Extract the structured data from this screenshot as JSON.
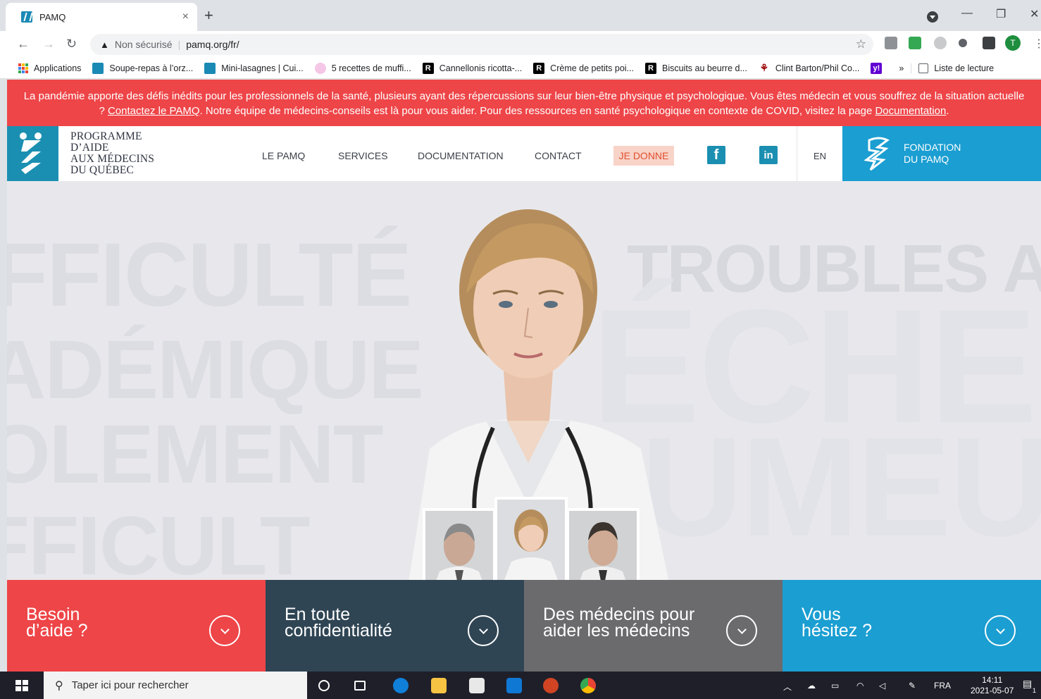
{
  "browser": {
    "tab_title": "PAMQ",
    "tab_close": "×",
    "new_tab": "+",
    "address_warning": "Non sécurisé",
    "address_url": "pamq.org/fr/",
    "bookmarks": [
      {
        "label": "Applications",
        "icon": "apps-grid-icon",
        "color": "#ea4335"
      },
      {
        "label": "Soupe-repas à l’orz...",
        "icon": "pamq-favicon-icon",
        "color": "#1a8ab5"
      },
      {
        "label": "Mini-lasagnes | Cui...",
        "icon": "pamq-favicon-icon",
        "color": "#1a8ab5"
      },
      {
        "label": "5 recettes de muffi...",
        "icon": "pink-circle-icon",
        "color": "#f5c6e6"
      },
      {
        "label": "Cannellonis ricotta-...",
        "icon": "r-icon",
        "color": "#000000"
      },
      {
        "label": "Crème de petits poi...",
        "icon": "r-icon",
        "color": "#000000"
      },
      {
        "label": "Biscuits au beurre d...",
        "icon": "r-icon",
        "color": "#000000"
      },
      {
        "label": "Clint Barton/Phil Co...",
        "icon": "ao3-icon",
        "color": "#990000"
      },
      {
        "label": "",
        "icon": "yahoo-icon",
        "color": "#6001d2"
      }
    ],
    "bookmarks_more": "»",
    "reading_list": "Liste de lecture"
  },
  "banner": {
    "text_1": "La pandémie apporte des défis inédits pour les professionnels de la santé, plusieurs ayant des répercussions sur leur bien-être physique et psychologique. Vous êtes médecin et vous souffrez de la situation actuelle ? ",
    "link_contact": "Contactez le PAMQ",
    "text_2": ". Notre équipe de médecins-conseils est là pour vous aider. Pour des ressources en santé psychologique en contexte de COVID, visitez la page ",
    "link_docs": "Documentation",
    "text_3": "."
  },
  "header": {
    "logo_lines": [
      "PROGRAMME",
      "D’AIDE",
      "AUX MÉDECINS",
      "DU QUÉBEC"
    ],
    "nav": [
      "LE PAMQ",
      "SERVICES",
      "DOCUMENTATION",
      "CONTACT"
    ],
    "donate": "JE DONNE",
    "lang": "EN",
    "fondation_line1": "FONDATION",
    "fondation_line2": "DU PAMQ",
    "brand_color": "#1b8fb1",
    "accent_color": "#ee4548"
  },
  "hero": {
    "bg_words": [
      "FFICULTÉ",
      "TROUBLES AN",
      "ADÉMIQUE",
      "ÉCHE",
      "OLEMENT",
      "UMEU",
      "FFICULT"
    ]
  },
  "cards": [
    {
      "line1": "Besoin",
      "line2": "d’aide ?",
      "color": "#ee4548"
    },
    {
      "line1": "En toute",
      "line2": "confidentialité",
      "color": "#2f4554"
    },
    {
      "line1": "Des médecins pour",
      "line2": "aider les médecins",
      "color": "#6b6b6d"
    },
    {
      "line1": "Vous",
      "line2": "hésitez ?",
      "color": "#1b9ed1"
    }
  ],
  "taskbar": {
    "search_placeholder": "Taper ici pour rechercher",
    "lang": "FRA",
    "time": "14:11",
    "date": "2021-05-07",
    "notifications": "1"
  }
}
